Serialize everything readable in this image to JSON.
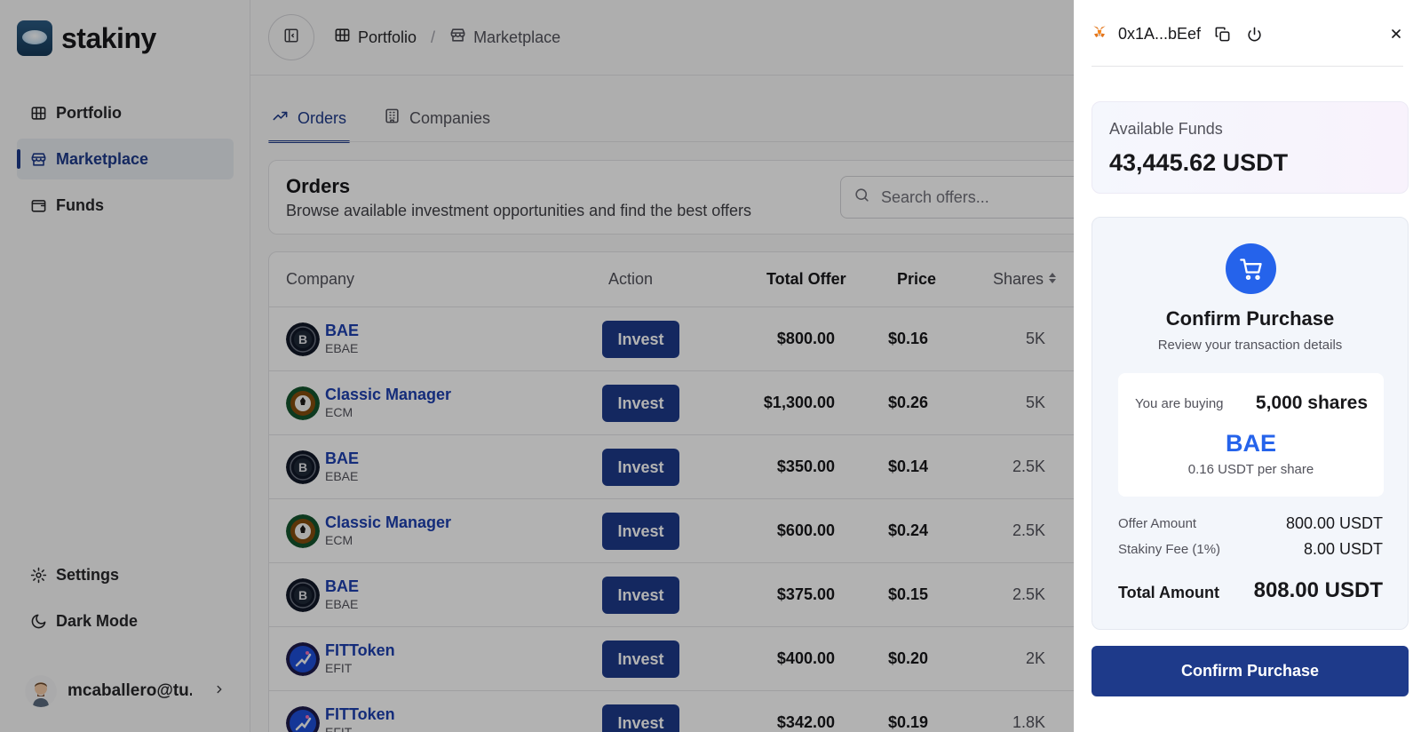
{
  "brand": {
    "name": "stakiny"
  },
  "sidebar": {
    "items": [
      {
        "label": "Portfolio",
        "icon": "building-icon"
      },
      {
        "label": "Marketplace",
        "icon": "store-icon"
      },
      {
        "label": "Funds",
        "icon": "wallet-icon"
      }
    ],
    "bottom": [
      {
        "label": "Settings",
        "icon": "gear-icon"
      },
      {
        "label": "Dark Mode",
        "icon": "moon-icon"
      }
    ],
    "user": {
      "email": "mcaballero@tu..."
    }
  },
  "breadcrumb": {
    "portfolio": "Portfolio",
    "separator": "/",
    "marketplace": "Marketplace"
  },
  "tabs": [
    {
      "label": "Orders"
    },
    {
      "label": "Companies"
    }
  ],
  "orders": {
    "title": "Orders",
    "subtitle": "Browse available investment opportunities and find the best offers",
    "search_placeholder": "Search offers..."
  },
  "table": {
    "headers": {
      "company": "Company",
      "action": "Action",
      "total_offer": "Total Offer",
      "price": "Price",
      "shares": "Shares"
    },
    "invest_label": "Invest",
    "rows": [
      {
        "company": "BAE",
        "ticker": "EBAE",
        "total": "$800.00",
        "price": "$0.16",
        "shares": "5K",
        "logo": "bae"
      },
      {
        "company": "Classic Manager",
        "ticker": "ECM",
        "total": "$1,300.00",
        "price": "$0.26",
        "shares": "5K",
        "logo": "ecm"
      },
      {
        "company": "BAE",
        "ticker": "EBAE",
        "total": "$350.00",
        "price": "$0.14",
        "shares": "2.5K",
        "logo": "bae"
      },
      {
        "company": "Classic Manager",
        "ticker": "ECM",
        "total": "$600.00",
        "price": "$0.24",
        "shares": "2.5K",
        "logo": "ecm"
      },
      {
        "company": "BAE",
        "ticker": "EBAE",
        "total": "$375.00",
        "price": "$0.15",
        "shares": "2.5K",
        "logo": "bae"
      },
      {
        "company": "FITToken",
        "ticker": "EFIT",
        "total": "$400.00",
        "price": "$0.20",
        "shares": "2K",
        "logo": "fit"
      },
      {
        "company": "FITToken",
        "ticker": "EFIT",
        "total": "$342.00",
        "price": "$0.19",
        "shares": "1.8K",
        "logo": "fit"
      }
    ]
  },
  "drawer": {
    "wallet_address": "0x1A...bEef",
    "funds_label": "Available Funds",
    "funds_value": "43,445.62 USDT",
    "confirm_title": "Confirm Purchase",
    "confirm_subtitle": "Review your transaction details",
    "buying_label": "You are buying",
    "buying_shares": "5,000 shares",
    "buying_company": "BAE",
    "per_share": "0.16 USDT per share",
    "offer_amount_label": "Offer Amount",
    "offer_amount_value": "800.00 USDT",
    "fee_label": "Stakiny Fee (1%)",
    "fee_value": "8.00 USDT",
    "total_label": "Total Amount",
    "total_value": "808.00 USDT",
    "confirm_button": "Confirm Purchase"
  },
  "colors": {
    "primary": "#1e3a8a",
    "accent": "#2563eb",
    "link": "#1e40af"
  }
}
